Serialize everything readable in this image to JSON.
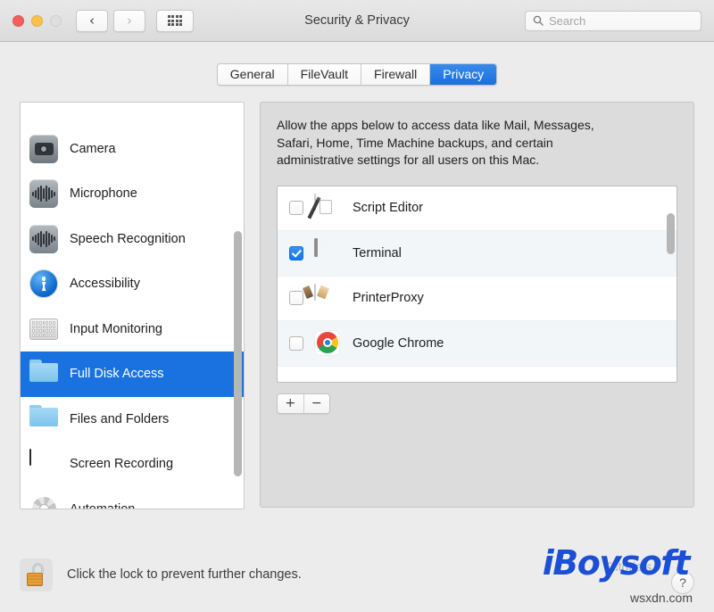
{
  "window": {
    "title": "Security & Privacy",
    "traffic_lights": [
      "close",
      "minimize",
      "zoom"
    ],
    "nav": {
      "back": "‹",
      "forward": "›"
    },
    "grid_button": "show-all-icon"
  },
  "search": {
    "placeholder": "Search",
    "value": "",
    "icon": "search-icon"
  },
  "tabs": [
    {
      "label": "General",
      "active": false
    },
    {
      "label": "FileVault",
      "active": false
    },
    {
      "label": "Firewall",
      "active": false
    },
    {
      "label": "Privacy",
      "active": true
    }
  ],
  "sidebar": {
    "items": [
      {
        "label": "",
        "icon": "location-services-icon",
        "selected": false,
        "partial": true
      },
      {
        "label": "Camera",
        "icon": "camera-icon",
        "selected": false
      },
      {
        "label": "Microphone",
        "icon": "microphone-icon",
        "selected": false
      },
      {
        "label": "Speech Recognition",
        "icon": "speech-recognition-icon",
        "selected": false
      },
      {
        "label": "Accessibility",
        "icon": "accessibility-icon",
        "selected": false
      },
      {
        "label": "Input Monitoring",
        "icon": "keyboard-icon",
        "selected": false
      },
      {
        "label": "Full Disk Access",
        "icon": "folder-icon",
        "selected": true
      },
      {
        "label": "Files and Folders",
        "icon": "folder-icon",
        "selected": false
      },
      {
        "label": "Screen Recording",
        "icon": "display-icon",
        "selected": false
      },
      {
        "label": "Automation",
        "icon": "gear-icon",
        "selected": false
      }
    ]
  },
  "main": {
    "description": "Allow the apps below to access data like Mail, Messages, Safari, Home, Time Machine backups, and certain administrative settings for all users on this Mac.",
    "apps": [
      {
        "name": "Script Editor",
        "icon": "script-editor-icon",
        "checked": false
      },
      {
        "name": "Terminal",
        "icon": "terminal-icon",
        "checked": true
      },
      {
        "name": "PrinterProxy",
        "icon": "printerproxy-icon",
        "checked": false
      },
      {
        "name": "Google Chrome",
        "icon": "chrome-icon",
        "checked": false
      }
    ],
    "add_label": "+",
    "remove_label": "−"
  },
  "footer": {
    "lock_icon": "unlocked-padlock-icon",
    "lock_text": "Click the lock to prevent further changes.",
    "help_label": "?"
  },
  "watermark": {
    "brand": "iBoysoft",
    "site": "wsxdn.com",
    "ghost": "Tutorials"
  },
  "colors": {
    "accent_blue": "#1a72e0",
    "tab_active": "#2a7de2",
    "checkbox_on": "#1277e8",
    "window_bg": "#ececec",
    "panel_bg": "#dcdcdc",
    "brand_blue": "#1a4fd6"
  }
}
